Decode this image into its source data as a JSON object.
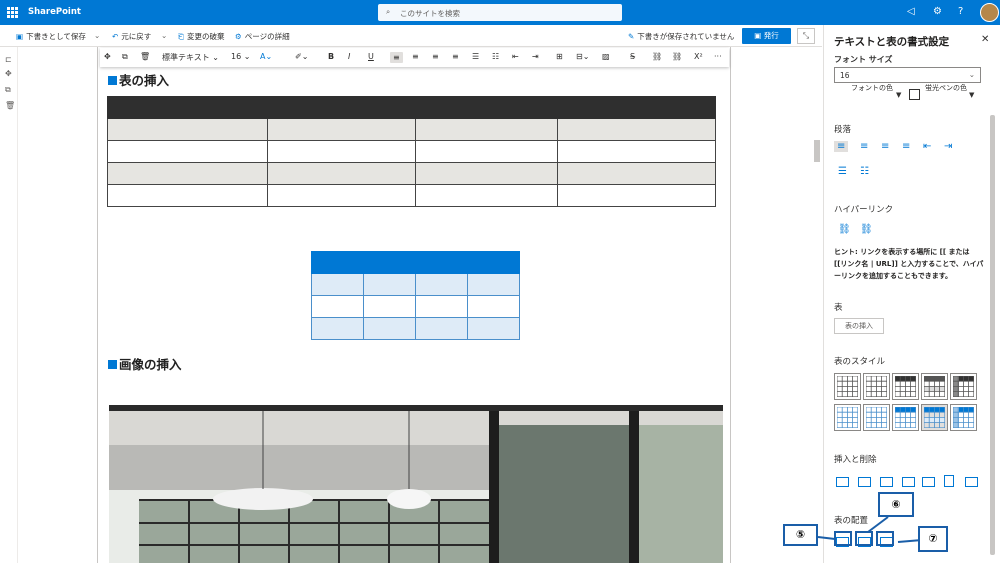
{
  "app": {
    "name": "SharePoint"
  },
  "search": {
    "placeholder": "このサイトを検索"
  },
  "toolbar": {
    "save_draft": "下書きとして保存",
    "undo": "元に戻す",
    "discard": "変更の破棄",
    "page_details": "ページの詳細",
    "status": "下書きが保存されていません",
    "publish": "発行"
  },
  "format_bar": {
    "style": "標準テキスト",
    "size": "16",
    "bold": "B",
    "italic": "I",
    "underline": "U",
    "superscript": "X²",
    "more": "···"
  },
  "content": {
    "heading_table": "表の挿入",
    "heading_image": "画像の挿入"
  },
  "pane": {
    "title": "テキストと表の書式設定",
    "font_size_label": "フォント サイズ",
    "font_size_value": "16",
    "font_color": "フォントの色",
    "highlight_color": "蛍光ペンの色",
    "paragraph": "段落",
    "hyperlink": "ハイパーリンク",
    "hint": "ヒント: リンクを表示する場所に [[ または [[リンク名 | URL]] と入力することで、ハイパーリンクを追加することもできます。",
    "table": "表",
    "insert_table": "表の挿入",
    "table_styles": "表のスタイル",
    "insert_delete": "挿入と削除",
    "alignment": "表の配置"
  },
  "callouts": [
    "⑤",
    "⑥",
    "⑦"
  ],
  "colors": {
    "brand": "#0078d4",
    "header_dark": "#2f2f2f",
    "row_alt": "#e6e5e1",
    "blue_light": "#deebf7"
  }
}
